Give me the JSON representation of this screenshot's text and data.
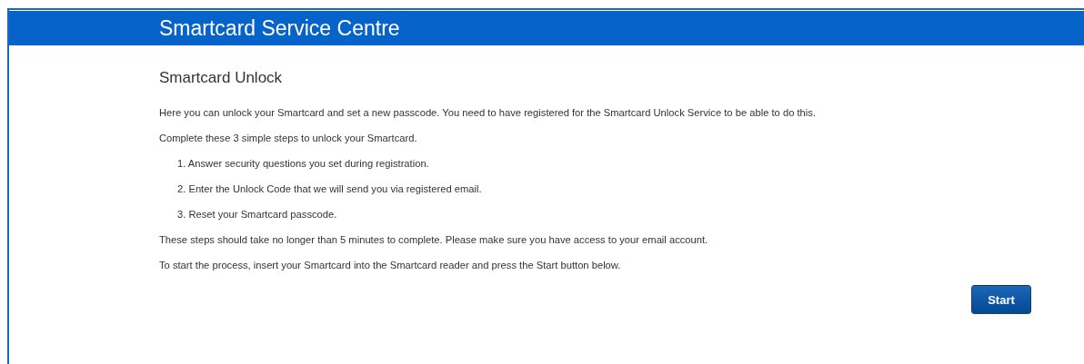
{
  "header": {
    "title": "Smartcard Service Centre"
  },
  "page": {
    "heading": "Smartcard Unlock",
    "intro": [
      "Here you can unlock your Smartcard and set a new passcode. You need to have registered for the Smartcard Unlock Service to be able to do this.",
      "Complete these 3 simple steps to unlock your Smartcard."
    ],
    "steps": [
      "1. Answer security questions you set during registration.",
      "2. Enter the Unlock Code that we will send you via registered email.",
      "3. Reset your Smartcard passcode."
    ],
    "notes": [
      "These steps should take no longer than 5 minutes to complete. Please make sure you have access to your email account.",
      "To start the process, insert your Smartcard into the Smartcard reader and press the Start button below."
    ],
    "button": "Start"
  }
}
